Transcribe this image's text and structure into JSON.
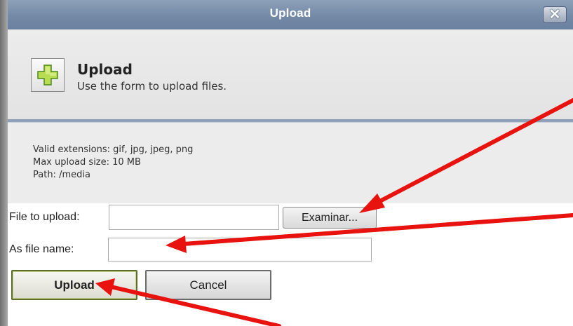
{
  "window": {
    "title": "Upload",
    "close_icon": "close-icon",
    "close_label": "✕"
  },
  "header": {
    "icon": "add-icon",
    "title": "Upload",
    "description": "Use the form to upload files."
  },
  "info": {
    "extensions": "Valid extensions: gif, jpg, jpeg, png",
    "max_size": "Max upload size: 10 MB",
    "path": "Path: /media"
  },
  "form": {
    "file_label": "File to upload:",
    "file_value": "",
    "browse_label": "Examinar...",
    "name_label": "As file name:",
    "name_value": ""
  },
  "buttons": {
    "upload_label": "Upload",
    "cancel_label": "Cancel"
  },
  "annotations": {
    "arrow_color": "#e8120f"
  }
}
